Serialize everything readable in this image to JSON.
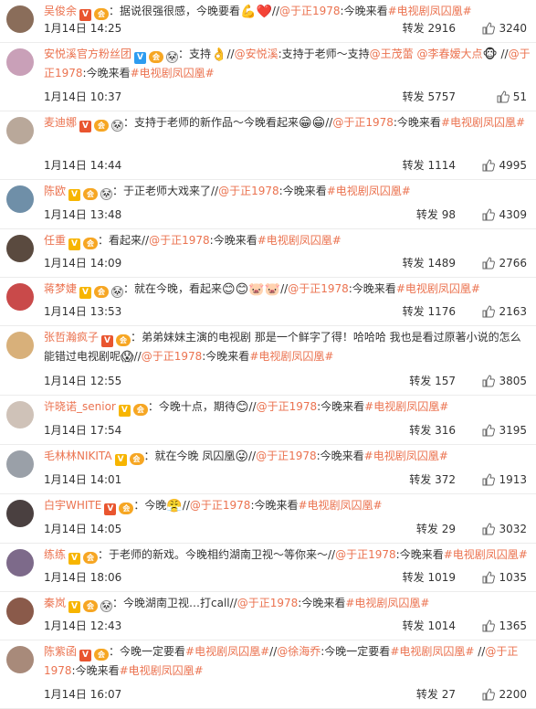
{
  "comments": [
    {
      "user": "吴俊余",
      "badges": [
        "v-red",
        "vip"
      ],
      "segments": [
        {
          "t": "：据说很强很感，今晚要看"
        },
        {
          "e": "💪"
        },
        {
          "e": "❤️"
        },
        {
          "t": "//"
        },
        {
          "m": "@于正1978"
        },
        {
          "t": ":今晚来看"
        },
        {
          "h": "#电视剧凤囚凰#"
        }
      ],
      "time": "1月14日 14:25",
      "repost": "转发 2916",
      "likes": "3240",
      "avatar_color": "#8a6d5a"
    },
    {
      "user": "安悦溪官方粉丝团",
      "badges": [
        "v-blue",
        "vip",
        "panda"
      ],
      "segments": [
        {
          "t": "：支持"
        },
        {
          "e": "👌"
        },
        {
          "t": "//"
        },
        {
          "m": "@安悦溪"
        },
        {
          "t": ":支持于老师～支持"
        },
        {
          "m": "@王茂蕾"
        },
        {
          "t": " "
        },
        {
          "m": "@李春嫒大点"
        },
        {
          "e": "🐵"
        },
        {
          "t": " //"
        },
        {
          "m": "@于正1978"
        },
        {
          "t": ":今晚来看"
        },
        {
          "h": "#电视剧凤囚凰#"
        }
      ],
      "time": "1月14日 10:37",
      "repost": "转发 5757",
      "likes": "51",
      "avatar_color": "#c9a0b8"
    },
    {
      "user": "麦迪娜",
      "badges": [
        "v-red",
        "vip",
        "panda"
      ],
      "segments": [
        {
          "t": "：支持于老师的新作品～今晚看起来"
        },
        {
          "e": "😁"
        },
        {
          "e": "😁"
        },
        {
          "t": "//"
        },
        {
          "m": "@于正1978"
        },
        {
          "t": ":今晚来看"
        },
        {
          "h": "#电视剧凤囚凰#"
        }
      ],
      "time": "1月14日 14:44",
      "repost": "转发 1114",
      "likes": "4995",
      "avatar_color": "#b9a89a"
    },
    {
      "user": "陈欧",
      "badges": [
        "v-gold",
        "vip",
        "panda"
      ],
      "segments": [
        {
          "t": "：于正老师大戏来了//"
        },
        {
          "m": "@于正1978"
        },
        {
          "t": ":今晚来看"
        },
        {
          "h": "#电视剧凤囚凰#"
        }
      ],
      "time": "1月14日 13:48",
      "repost": "转发 98",
      "likes": "4309",
      "avatar_color": "#6f8fa8"
    },
    {
      "user": "任重",
      "badges": [
        "v-gold",
        "vip"
      ],
      "segments": [
        {
          "t": "：看起来//"
        },
        {
          "m": "@于正1978"
        },
        {
          "t": ":今晚来看"
        },
        {
          "h": "#电视剧凤囚凰#"
        }
      ],
      "time": "1月14日 14:09",
      "repost": "转发 1489",
      "likes": "2766",
      "avatar_color": "#5a4a3f"
    },
    {
      "user": "蒋梦婕",
      "badges": [
        "v-gold",
        "vip",
        "panda"
      ],
      "segments": [
        {
          "t": "：就在今晚，看起来"
        },
        {
          "e": "😊"
        },
        {
          "e": "😊"
        },
        {
          "e": "🐷"
        },
        {
          "e": "🐷"
        },
        {
          "t": "//"
        },
        {
          "m": "@于正1978"
        },
        {
          "t": ":今晚来看"
        },
        {
          "h": "#电视剧凤囚凰#"
        }
      ],
      "time": "1月14日 13:53",
      "repost": "转发 1176",
      "likes": "2163",
      "avatar_color": "#c94a4a"
    },
    {
      "user": "张哲瀚疯子",
      "badges": [
        "v-red",
        "vip"
      ],
      "segments": [
        {
          "t": "：弟弟妹妹主演的电视剧 那是一个鲜字了得！哈哈哈 我也是看过原著小说的怎么能错过电视剧呢"
        },
        {
          "e": "😱"
        },
        {
          "t": "//"
        },
        {
          "m": "@于正1978"
        },
        {
          "t": ":今晚来看"
        },
        {
          "h": "#电视剧凤囚凰#"
        }
      ],
      "time": "1月14日 12:55",
      "repost": "转发 157",
      "likes": "3805",
      "avatar_color": "#d8b07a"
    },
    {
      "user": "许晓诺_senior",
      "badges": [
        "v-gold",
        "vip"
      ],
      "segments": [
        {
          "t": "：今晚十点，期待"
        },
        {
          "e": "😊"
        },
        {
          "t": "//"
        },
        {
          "m": "@于正1978"
        },
        {
          "t": ":今晚来看"
        },
        {
          "h": "#电视剧凤囚凰#"
        }
      ],
      "time": "1月14日 17:54",
      "repost": "转发 316",
      "likes": "3195",
      "avatar_color": "#cfc2b8"
    },
    {
      "user": "毛林林NIKITA",
      "badges": [
        "v-gold",
        "vip"
      ],
      "segments": [
        {
          "t": "：就在今晚 凤囚凰"
        },
        {
          "e": "😜"
        },
        {
          "t": "//"
        },
        {
          "m": "@于正1978"
        },
        {
          "t": ":今晚来看"
        },
        {
          "h": "#电视剧凤囚凰#"
        }
      ],
      "time": "1月14日 14:01",
      "repost": "转发 372",
      "likes": "1913",
      "avatar_color": "#9aa0a8"
    },
    {
      "user": "白宇WHITE",
      "badges": [
        "v-red",
        "vip"
      ],
      "segments": [
        {
          "t": "：今晚"
        },
        {
          "e": "😤"
        },
        {
          "t": "//"
        },
        {
          "m": "@于正1978"
        },
        {
          "t": ":今晚来看"
        },
        {
          "h": "#电视剧凤囚凰#"
        }
      ],
      "time": "1月14日 14:05",
      "repost": "转发 29",
      "likes": "3032",
      "avatar_color": "#4a4040"
    },
    {
      "user": "练练",
      "badges": [
        "v-gold",
        "vip"
      ],
      "segments": [
        {
          "t": "：于老师的新戏。今晚相约湖南卫视～等你来～//"
        },
        {
          "m": "@于正1978"
        },
        {
          "t": ":今晚来看"
        },
        {
          "h": "#电视剧凤囚凰#"
        }
      ],
      "time": "1月14日 18:06",
      "repost": "转发 1019",
      "likes": "1035",
      "avatar_color": "#7d6a8a"
    },
    {
      "user": "秦岚",
      "badges": [
        "v-gold",
        "vip",
        "panda"
      ],
      "segments": [
        {
          "t": "：今晚湖南卫视…打call//"
        },
        {
          "m": "@于正1978"
        },
        {
          "t": ":今晚来看"
        },
        {
          "h": "#电视剧凤囚凰#"
        }
      ],
      "time": "1月14日 12:43",
      "repost": "转发 1014",
      "likes": "1365",
      "avatar_color": "#8a5a4a"
    },
    {
      "user": "陈紫函",
      "badges": [
        "v-red",
        "vip"
      ],
      "segments": [
        {
          "t": "：今晚一定要看"
        },
        {
          "h": "#电视剧凤囚凰#"
        },
        {
          "t": "//"
        },
        {
          "m": "@徐海乔"
        },
        {
          "t": ":今晚一定要看"
        },
        {
          "h": "#电视剧凤囚凰#"
        },
        {
          "t": " //"
        },
        {
          "m": "@于正1978"
        },
        {
          "t": ":今晚来看"
        },
        {
          "h": "#电视剧凤囚凰#"
        }
      ],
      "time": "1月14日 16:07",
      "repost": "转发 27",
      "likes": "2200",
      "avatar_color": "#a88a7a"
    }
  ],
  "colors": {
    "link": "#eb7350",
    "text": "#333333"
  }
}
